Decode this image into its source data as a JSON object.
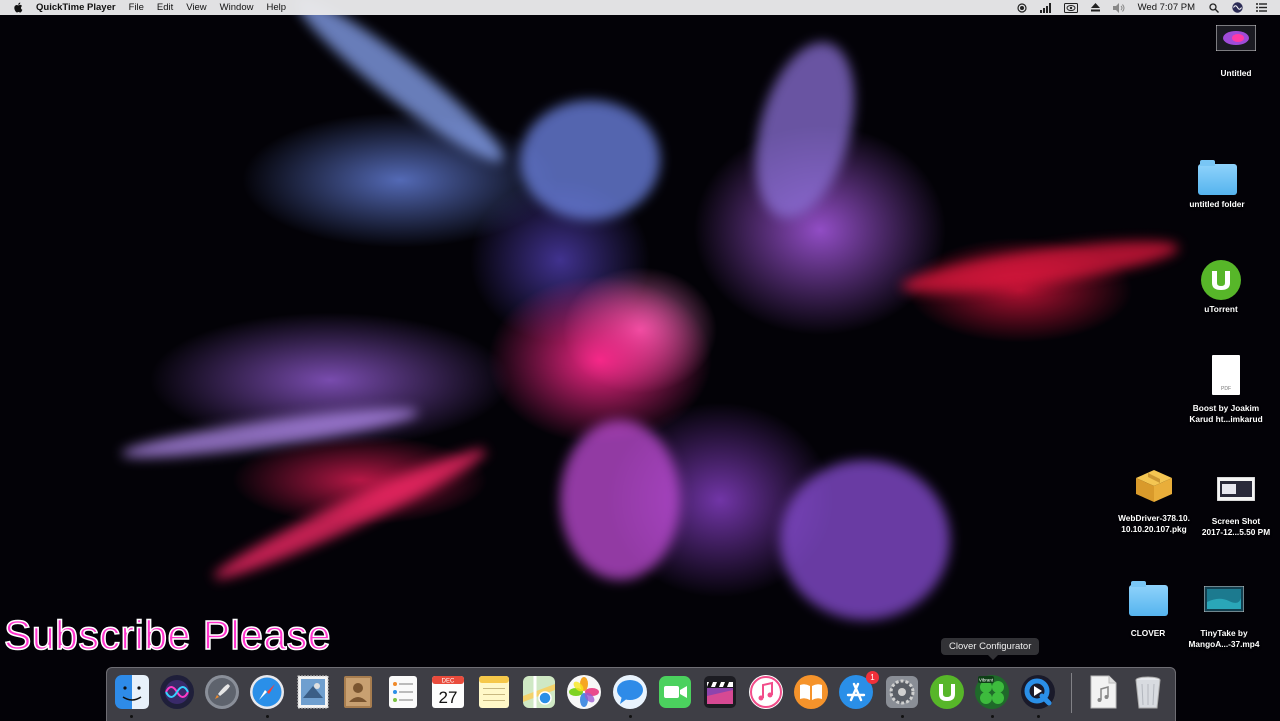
{
  "menubar": {
    "app_name": "QuickTime Player",
    "menus": [
      "File",
      "Edit",
      "View",
      "Window",
      "Help"
    ],
    "clock": "Wed 7:07 PM"
  },
  "desktop": {
    "items": [
      {
        "label": "Untitled"
      },
      {
        "label": "untitled folder"
      },
      {
        "label": "uTorrent"
      },
      {
        "label_line1": "Boost by Joakim",
        "label_line2": "Karud ht...imkarud",
        "doc_badge": "PDF"
      },
      {
        "label_line1": "WebDriver-378.10.",
        "label_line2": "10.10.20.107.pkg"
      },
      {
        "label_line1": "Screen Shot",
        "label_line2": "2017-12...5.50 PM"
      },
      {
        "label": "CLOVER"
      },
      {
        "label_line1": "TinyTake by",
        "label_line2": "MangoA...-37.mp4"
      }
    ]
  },
  "overlay_text": "Subscribe Please",
  "tooltip": "Clover Configurator",
  "dock": {
    "calendar": {
      "month": "DEC",
      "day": "27"
    },
    "app_store_badge": "1",
    "vibrant_label": "Vibrant"
  },
  "colors": {
    "subscribe_fill": "#ff33cc",
    "utorrent_green": "#57b629",
    "folder_blue": "#6cc3f5",
    "badge_red": "#f0303a"
  }
}
